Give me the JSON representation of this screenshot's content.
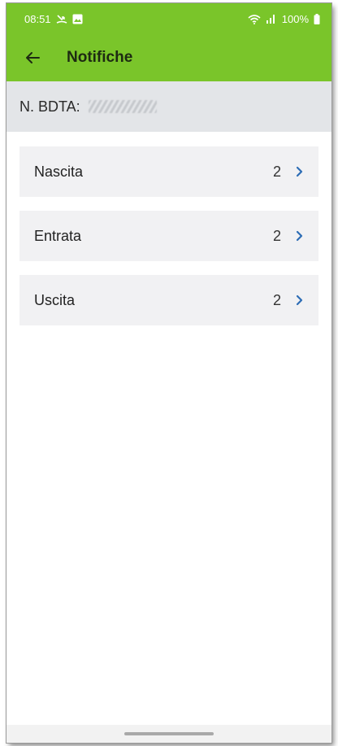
{
  "status_bar": {
    "time": "08:51",
    "battery": "100%",
    "icons": [
      "missed-call-icon",
      "image-icon",
      "wifi-icon",
      "signal-icon",
      "battery-icon"
    ]
  },
  "app_bar": {
    "title": "Notifiche",
    "back_icon": "arrow-left-icon"
  },
  "subheader": {
    "label": "N. BDTA:",
    "value_redacted": true
  },
  "notifications": [
    {
      "label": "Nascita",
      "count": "2"
    },
    {
      "label": "Entrata",
      "count": "2"
    },
    {
      "label": "Uscita",
      "count": "2"
    }
  ],
  "colors": {
    "accent": "#7ac52a",
    "subheader_bg": "#e3e5e8",
    "item_bg": "#f1f1f3",
    "chevron": "#2d6db5"
  }
}
